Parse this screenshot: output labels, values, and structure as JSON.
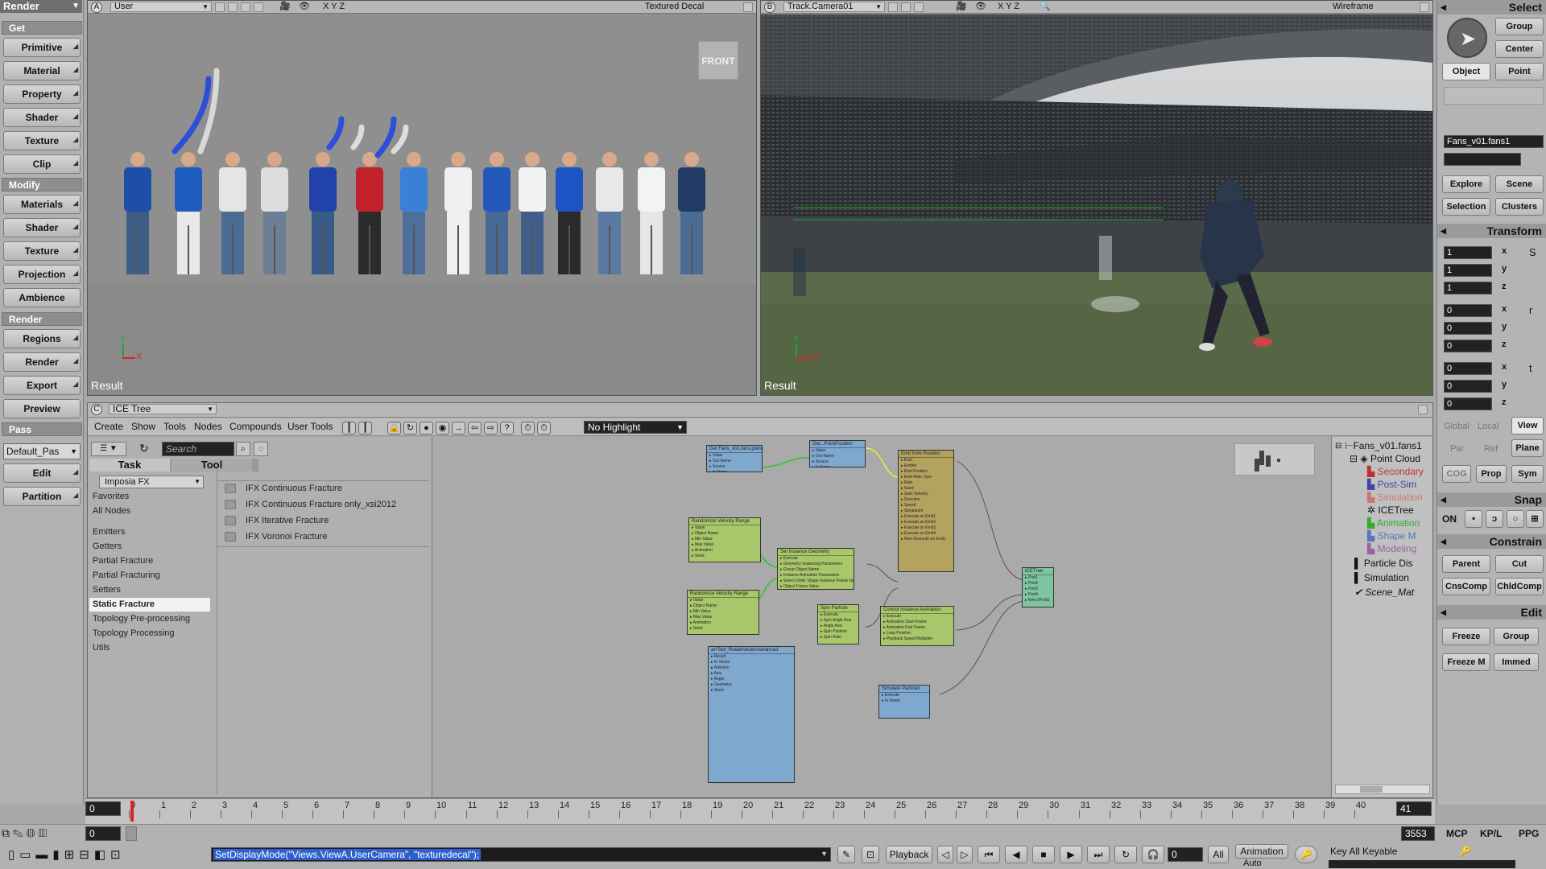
{
  "left_toolbar": {
    "title": "Render",
    "sections": [
      {
        "label": "Get",
        "items": [
          "Primitive",
          "Material",
          "Property",
          "Shader",
          "Texture",
          "Clip"
        ]
      },
      {
        "label": "Modify",
        "items": [
          "Materials",
          "Shader",
          "Texture",
          "Projection",
          "Ambience"
        ]
      },
      {
        "label": "Render",
        "items": [
          "Regions",
          "Render",
          "Export",
          "Preview"
        ]
      }
    ],
    "pass_label": "Pass",
    "pass_value": "Default_Pas",
    "pass_items": [
      "Edit",
      "Partition"
    ]
  },
  "viewport_a": {
    "letter": "A",
    "camera": "User",
    "axes": "X Y Z",
    "mode": "Textured Decal",
    "cube_label": "FRONT",
    "result": "Result"
  },
  "viewport_b": {
    "letter": "B",
    "camera": "Track.Camera01",
    "axes": "X Y Z",
    "mode": "Wireframe",
    "result": "Result"
  },
  "ice": {
    "letter": "C",
    "title": "ICE Tree",
    "menu": [
      "Create",
      "Show",
      "Tools",
      "Nodes",
      "Compounds",
      "User Tools"
    ],
    "highlight": "No Highlight",
    "search_placeholder": "Search",
    "tabs": [
      "Task",
      "Tool"
    ],
    "library": "Imposia FX",
    "categories": [
      "Favorites",
      "All Nodes",
      "Emitters",
      "Getters",
      "Partial Fracture",
      "Partial Fracturing",
      "Setters",
      "Static Fracture",
      "Topology Pre-processing",
      "Topology Processing",
      "Utils"
    ],
    "selected_category": "Static Fracture",
    "items": [
      "IFX Continuous Fracture",
      "IFX Continuous Fracture only_xsi2012",
      "IFX Iterative Fracture",
      "IFX Voronoi Fracture"
    ],
    "nodes": [
      {
        "title": "Get Fans_v01.fans.pointpos",
        "ports": [
          "Value",
          "Out Name",
          "Source",
          "In Name"
        ]
      },
      {
        "title": "Get...PointPosition",
        "ports": [
          "Value",
          "Out Name",
          "Source",
          "In Name"
        ]
      },
      {
        "title": "Emit from Position",
        "ports": [
          "Emit",
          "Emitter",
          "Emit Position",
          "Emit Rate Type",
          "Rate",
          "Seed",
          "Start Velocity",
          "Direction",
          "Speed",
          "Simulation",
          "Execute on Emit1",
          "Execute on Emit2",
          "Execute on Emit3",
          "Execute on Emit4",
          "New (Execute on Emit)"
        ]
      },
      {
        "title": "Randomize Velocity Range",
        "ports": [
          "Value",
          "Object Name",
          "Min Value",
          "Max Value",
          "Animation",
          "Seed"
        ]
      },
      {
        "title": "Set Instance Geometry",
        "ports": [
          "Execute",
          "Geometry Instancing Parameters",
          "Group Object Name",
          "Instance Animation Parameters",
          "Select Order Shape Instance Frame Values",
          "Object Frame Value"
        ]
      },
      {
        "title": "Randomize Velocity Range",
        "ports": [
          "Value",
          "Object Name",
          "Min Value",
          "Max Value",
          "Animation",
          "Seed"
        ]
      },
      {
        "title": "Spin Particle",
        "ports": [
          "Execute",
          "Spin Angle Axis",
          "Angle Axis",
          "Spin Position",
          "Spin Rate"
        ]
      },
      {
        "title": "Control Instance Animation",
        "ports": [
          "Execute",
          "Animation Start Frame",
          "Animation End Frame",
          "Loop Position",
          "Playback Speed Multiplier"
        ]
      },
      {
        "title": "ICETree",
        "ports": [
          "Port1",
          "Port2",
          "Port3",
          "Port4",
          "New (Port5)"
        ]
      },
      {
        "title": "arrTool_RotateVectorAdvanced",
        "ports": [
          "Result",
          "In Vector",
          "Rotation",
          "Axis",
          "Angle",
          "Geometry",
          "Seed"
        ]
      },
      {
        "title": "Simulate Particles",
        "ports": [
          "Execute",
          "In Name"
        ]
      }
    ]
  },
  "explorer": {
    "root": "Fans_v01.fans1",
    "rows": [
      "Point Cloud",
      "Secondary",
      "Post-Sim",
      "Simulation",
      "ICETree",
      "Animation",
      "Shape M",
      "Modeling",
      "Particle Dis",
      "Simulation",
      "Scene_Mat"
    ]
  },
  "right_panel": {
    "select_title": "Select",
    "group": "Group",
    "center": "Center",
    "object": "Object",
    "point": "Point",
    "selection_name": "Fans_v01.fans1",
    "explore": "Explore",
    "scene": "Scene",
    "selection": "Selection",
    "clusters": "Clusters",
    "transform_title": "Transform",
    "scale": [
      "1",
      "1",
      "1"
    ],
    "rotate": [
      "0",
      "0",
      "0"
    ],
    "translate": [
      "0",
      "0",
      "0"
    ],
    "axis": [
      "x",
      "y",
      "z"
    ],
    "ref_tabs": [
      "Global",
      "Local",
      "View",
      "Par",
      "Ref",
      "Plane"
    ],
    "cog": "COG",
    "prop": "Prop",
    "sym": "Sym",
    "snap_title": "Snap",
    "on": "ON",
    "constrain_title": "Constrain",
    "parent": "Parent",
    "cut": "Cut",
    "cnscomp": "CnsComp",
    "childcomp": "ChldComp",
    "edit_title": "Edit",
    "freeze": "Freeze",
    "edit_group": "Group",
    "freeze_m": "Freeze M",
    "immed": "Immed"
  },
  "timeline": {
    "start_top": "0",
    "start_bottom": "0",
    "ticks": [
      "0",
      "1",
      "2",
      "3",
      "4",
      "5",
      "6",
      "7",
      "8",
      "9",
      "10",
      "11",
      "12",
      "13",
      "14",
      "15",
      "16",
      "17",
      "18",
      "19",
      "20",
      "21",
      "22",
      "23",
      "24",
      "25",
      "26",
      "27",
      "28",
      "29",
      "30",
      "31",
      "32",
      "33",
      "34",
      "35",
      "36",
      "37",
      "38",
      "39",
      "40"
    ],
    "end": "41",
    "end_total": "3553",
    "tabs": [
      "MCP",
      "KP/L",
      "PPG"
    ]
  },
  "bottom": {
    "command": "SetDisplayMode(\"Views.ViewA.UserCamera\", \"texturedecal\");",
    "playback": "Playback",
    "frame": "0",
    "all": "All",
    "animation": "Animation",
    "auto": "Auto",
    "key_all": "Key All Keyable"
  }
}
